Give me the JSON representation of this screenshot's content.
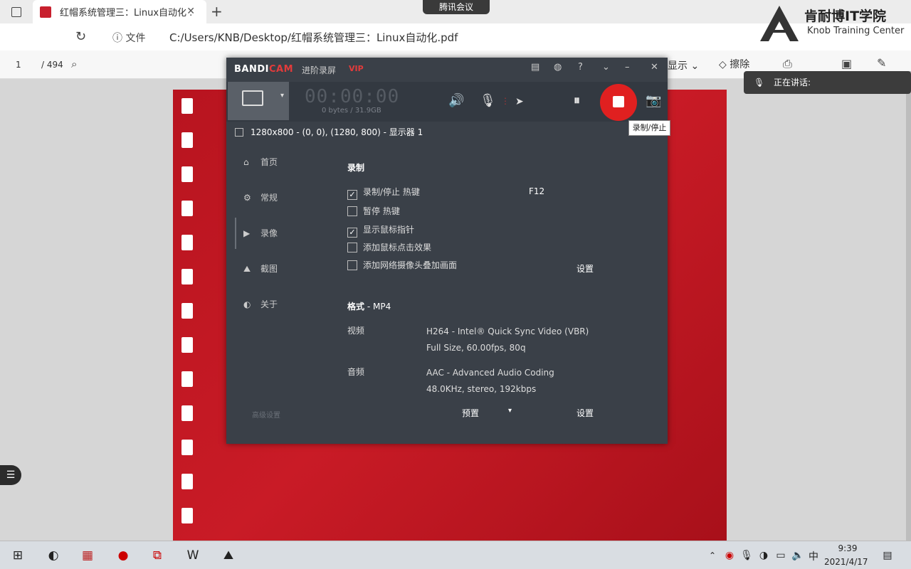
{
  "browser": {
    "tab_title": "红帽系统管理三：Linux自动化 .",
    "new_tab": "+",
    "meeting_label": "腾讯会议",
    "file_label": "文件",
    "url": "C:/Users/KNB/Desktop/红帽系统管理三：Linux自动化.pdf"
  },
  "pdf_toolbar": {
    "page": "1",
    "page_total": "/ 494",
    "show_label": "显示",
    "erase_label": "擦除"
  },
  "brand": {
    "title": "肯耐博IT学院",
    "subtitle": "Knob Training Center"
  },
  "speaking": {
    "label": "正在讲话:"
  },
  "bandicam": {
    "logo_a": "BANDI",
    "logo_b": "CAM",
    "mode": "进阶录屏",
    "vip": "VIP",
    "timer": "00:00:00",
    "size_text": "0 bytes / 31.9GB",
    "tooltip": "录制/停止",
    "area": "1280x800 - (0, 0), (1280, 800) - 显示器 1",
    "nav": [
      {
        "label": "首页"
      },
      {
        "label": "常规"
      },
      {
        "label": "录像"
      },
      {
        "label": "截图"
      },
      {
        "label": "关于"
      }
    ],
    "section_record": "录制",
    "options": [
      {
        "label": "录制/停止 热键",
        "checked": true
      },
      {
        "label": "暂停 热键",
        "checked": false
      },
      {
        "label": "显示鼠标指针",
        "checked": true
      },
      {
        "label": "添加鼠标点击效果",
        "checked": false
      },
      {
        "label": "添加网络摄像头叠加画面",
        "checked": false
      }
    ],
    "hotkey": "F12",
    "webcam_settings": "设置",
    "format_label": "格式",
    "format_value": " - MP4",
    "video_label": "视频",
    "video_line1": "H264 - Intel® Quick Sync Video (VBR)",
    "video_line2": "Full Size, 60.00fps, 80q",
    "audio_label": "音频",
    "audio_line1": "AAC - Advanced Audio Coding",
    "audio_line2": "48.0KHz, stereo, 192kbps",
    "footer_left": "高级设置",
    "preset": "预置",
    "format_settings": "设置"
  },
  "taskbar": {
    "time": "9:39",
    "date": "2021/4/17",
    "ime": "中"
  }
}
